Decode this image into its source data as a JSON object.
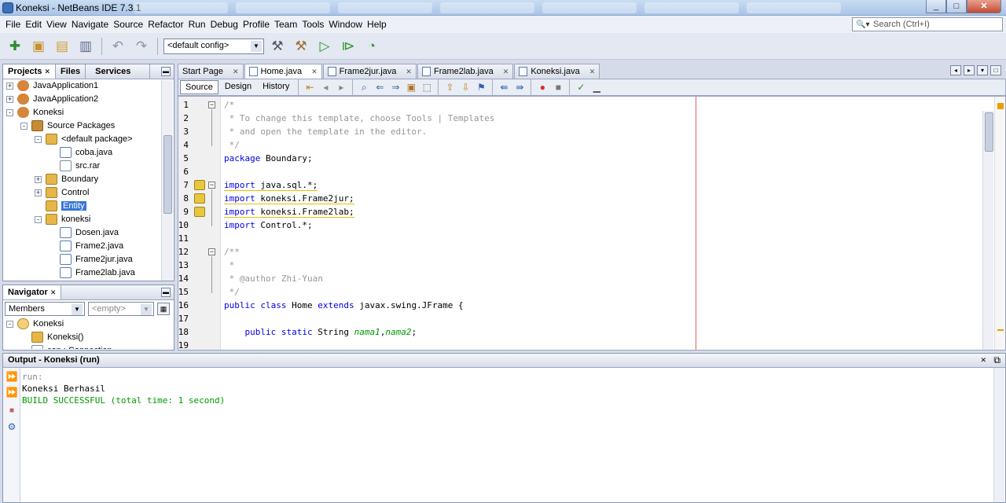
{
  "window": {
    "title": "Koneksi - NetBeans IDE 7.3.1",
    "controls": [
      "minimize",
      "maximize",
      "close"
    ]
  },
  "menu": [
    "File",
    "Edit",
    "View",
    "Navigate",
    "Source",
    "Refactor",
    "Run",
    "Debug",
    "Profile",
    "Team",
    "Tools",
    "Window",
    "Help"
  ],
  "search": {
    "placeholder": "Search (Ctrl+I)"
  },
  "toolbar": {
    "config_value": "<default config>"
  },
  "projects_panel": {
    "tabs": [
      "Projects",
      "Files",
      "Services"
    ],
    "tree": [
      {
        "label": "JavaApplication1",
        "depth": 0,
        "expander": "+",
        "icon": "cup"
      },
      {
        "label": "JavaApplication2",
        "depth": 0,
        "expander": "+",
        "icon": "cup"
      },
      {
        "label": "Koneksi",
        "depth": 0,
        "expander": "-",
        "icon": "cup"
      },
      {
        "label": "Source Packages",
        "depth": 1,
        "expander": "-",
        "icon": "src"
      },
      {
        "label": "<default package>",
        "depth": 2,
        "expander": "-",
        "icon": "pkg"
      },
      {
        "label": "coba.java",
        "depth": 3,
        "expander": "",
        "icon": "java"
      },
      {
        "label": "src.rar",
        "depth": 3,
        "expander": "",
        "icon": "file"
      },
      {
        "label": "Boundary",
        "depth": 2,
        "expander": "+",
        "icon": "pkg"
      },
      {
        "label": "Control",
        "depth": 2,
        "expander": "+",
        "icon": "pkg"
      },
      {
        "label": "Entity",
        "depth": 2,
        "expander": "",
        "icon": "pkg",
        "selected": true
      },
      {
        "label": "koneksi",
        "depth": 2,
        "expander": "-",
        "icon": "pkg"
      },
      {
        "label": "Dosen.java",
        "depth": 3,
        "expander": "",
        "icon": "java"
      },
      {
        "label": "Frame2.java",
        "depth": 3,
        "expander": "",
        "icon": "java"
      },
      {
        "label": "Frame2jur.java",
        "depth": 3,
        "expander": "",
        "icon": "java"
      },
      {
        "label": "Frame2lab.java",
        "depth": 3,
        "expander": "",
        "icon": "java"
      }
    ]
  },
  "navigator": {
    "title": "Navigator",
    "filter_value": "Members",
    "second_value": "<empty>",
    "tree": [
      {
        "label": "Koneksi",
        "depth": 0,
        "expander": "-",
        "icon": "cls"
      },
      {
        "label": "Koneksi()",
        "depth": 1,
        "expander": "",
        "icon": "pkg"
      },
      {
        "label": "con : Connection",
        "depth": 1,
        "expander": "",
        "icon": "file"
      }
    ]
  },
  "editor": {
    "tabs": [
      "Start Page",
      "Home.java",
      "Frame2jur.java",
      "Frame2lab.java",
      "Koneksi.java"
    ],
    "active_tab": "Home.java",
    "view_tabs": [
      "Source",
      "Design",
      "History"
    ],
    "lines": [
      {
        "n": "1",
        "parts": [
          {
            "c": "cm",
            "t": "/*"
          }
        ]
      },
      {
        "n": "2",
        "parts": [
          {
            "c": "cm",
            "t": " * To change this template, choose Tools | Templates"
          }
        ]
      },
      {
        "n": "3",
        "parts": [
          {
            "c": "cm",
            "t": " * and open the template in the editor."
          }
        ]
      },
      {
        "n": "4",
        "parts": [
          {
            "c": "cm",
            "t": " */"
          }
        ]
      },
      {
        "n": "5",
        "parts": [
          {
            "c": "kw",
            "t": "package"
          },
          {
            "c": "ty",
            "t": " Boundary;"
          }
        ]
      },
      {
        "n": "6",
        "parts": []
      },
      {
        "n": "7",
        "parts": [
          {
            "c": "kw",
            "t": "import"
          },
          {
            "c": "ty",
            "t": " java.sql.*;"
          }
        ],
        "warn": true
      },
      {
        "n": "8",
        "parts": [
          {
            "c": "kw",
            "t": "import"
          },
          {
            "c": "ty",
            "t": " koneksi.Frame2jur;"
          }
        ],
        "warn": true
      },
      {
        "n": "9",
        "parts": [
          {
            "c": "kw",
            "t": "import"
          },
          {
            "c": "ty",
            "t": " koneksi.Frame2lab;"
          }
        ],
        "warn": true
      },
      {
        "n": "10",
        "parts": [
          {
            "c": "kw",
            "t": "import"
          },
          {
            "c": "ty",
            "t": " Control.*;"
          }
        ]
      },
      {
        "n": "11",
        "parts": []
      },
      {
        "n": "12",
        "parts": [
          {
            "c": "cm",
            "t": "/**"
          }
        ]
      },
      {
        "n": "13",
        "parts": [
          {
            "c": "cm",
            "t": " *"
          }
        ]
      },
      {
        "n": "14",
        "parts": [
          {
            "c": "cm",
            "t": " * @author Zhi-Yuan"
          }
        ]
      },
      {
        "n": "15",
        "parts": [
          {
            "c": "cm",
            "t": " */"
          }
        ]
      },
      {
        "n": "16",
        "parts": [
          {
            "c": "kw",
            "t": "public class"
          },
          {
            "c": "ty",
            "t": " Home "
          },
          {
            "c": "kw",
            "t": "extends"
          },
          {
            "c": "ty",
            "t": " javax.swing.JFrame {"
          }
        ]
      },
      {
        "n": "17",
        "parts": []
      },
      {
        "n": "18",
        "parts": [
          {
            "c": "kw",
            "t": "    public static"
          },
          {
            "c": "ty",
            "t": " String "
          },
          {
            "c": "fi",
            "t": "nama1"
          },
          {
            "c": "ty",
            "t": ","
          },
          {
            "c": "fi",
            "t": "nama2"
          },
          {
            "c": "ty",
            "t": ";"
          }
        ]
      },
      {
        "n": "19",
        "parts": []
      }
    ]
  },
  "output": {
    "title": "Output - Koneksi (run)",
    "lines": [
      {
        "c": "#888888",
        "t": "run:"
      },
      {
        "c": "#000000",
        "t": "Koneksi Berhasil"
      },
      {
        "c": "#009900",
        "t": "BUILD SUCCESSFUL (total time: 1 second)"
      }
    ]
  }
}
